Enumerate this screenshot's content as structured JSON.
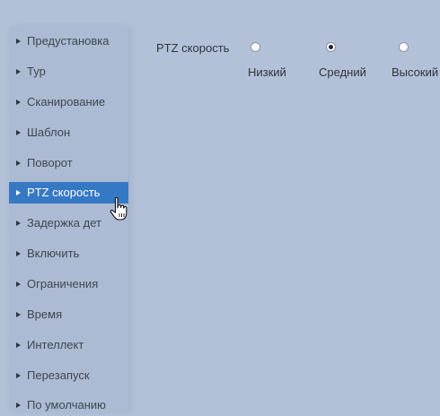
{
  "sidebar": {
    "items": [
      {
        "label": "Предустановка"
      },
      {
        "label": "Тур"
      },
      {
        "label": "Сканирование"
      },
      {
        "label": "Шаблон"
      },
      {
        "label": "Поворот"
      },
      {
        "label": "PTZ скорость"
      },
      {
        "label": "Задержка дет"
      },
      {
        "label": "Включить"
      },
      {
        "label": "Ограничения"
      },
      {
        "label": "Время"
      },
      {
        "label": "Интеллект"
      },
      {
        "label": "Перезапуск"
      },
      {
        "label": "По умолчанию"
      }
    ],
    "active_item": "PTZ скорость"
  },
  "ptz_speed": {
    "label": "PTZ скорость",
    "options": [
      {
        "label": "Низкий",
        "selected": false
      },
      {
        "label": "Средний",
        "selected": true
      },
      {
        "label": "Высокий",
        "selected": false
      }
    ]
  },
  "colors": {
    "background": "#b3c1d8",
    "active_item": "#3579c4"
  }
}
